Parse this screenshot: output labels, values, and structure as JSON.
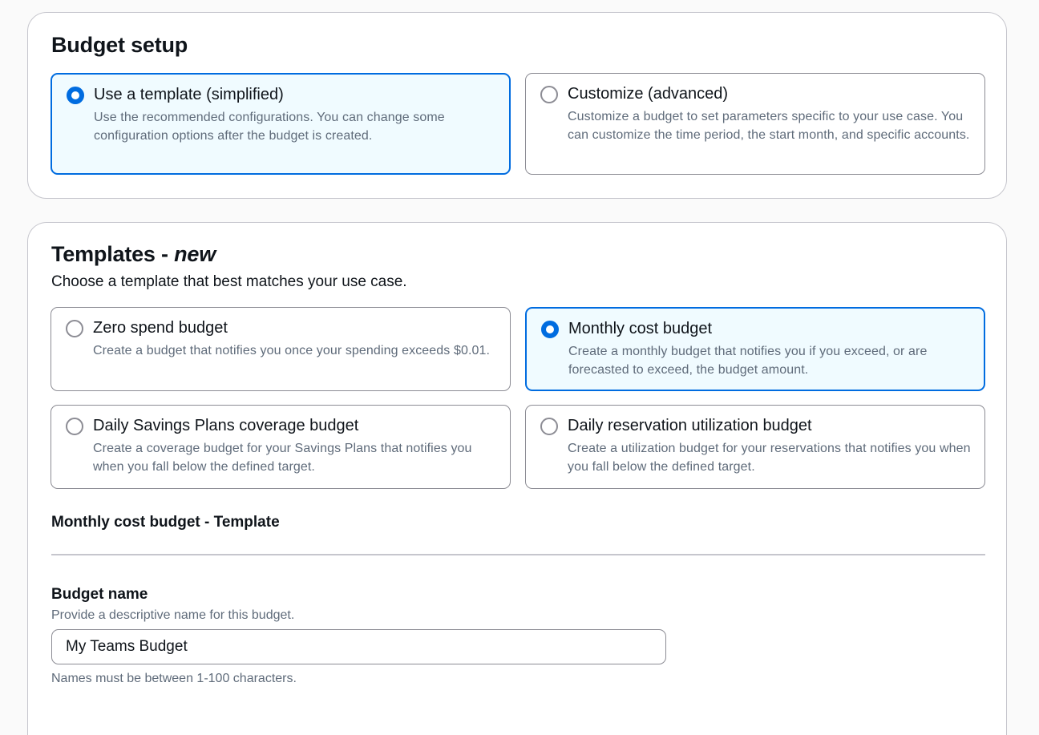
{
  "budget_setup": {
    "title": "Budget setup",
    "options": [
      {
        "label": "Use a template (simplified)",
        "description": "Use the recommended configurations. You can change some configuration options after the budget is created.",
        "selected": true
      },
      {
        "label": "Customize (advanced)",
        "description": "Customize a budget to set parameters specific to your use case. You can customize the time period, the start month, and specific accounts.",
        "selected": false
      }
    ]
  },
  "templates": {
    "title": "Templates - ",
    "title_emphasis": "new",
    "description": "Choose a template that best matches your use case.",
    "options": [
      {
        "label": "Zero spend budget",
        "description": "Create a budget that notifies you once your spending exceeds $0.01.",
        "selected": false
      },
      {
        "label": "Monthly cost budget",
        "description": "Create a monthly budget that notifies you if you exceed, or are forecasted to exceed, the budget amount.",
        "selected": true
      },
      {
        "label": "Daily Savings Plans coverage budget",
        "description": "Create a coverage budget for your Savings Plans that notifies you when you fall below the defined target.",
        "selected": false
      },
      {
        "label": "Daily reservation utilization budget",
        "description": "Create a utilization budget for your reservations that notifies you when you fall below the defined target.",
        "selected": false
      }
    ]
  },
  "template_section": {
    "heading": "Monthly cost budget - Template"
  },
  "budget_name": {
    "label": "Budget name",
    "description": "Provide a descriptive name for this budget.",
    "value": "My Teams Budget",
    "constraint": "Names must be between 1-100 characters."
  },
  "colors": {
    "accent": "#006ce0",
    "selected_background": "#f0fbff",
    "border": "#8c8c94",
    "secondary_text": "#5f6b7a"
  }
}
